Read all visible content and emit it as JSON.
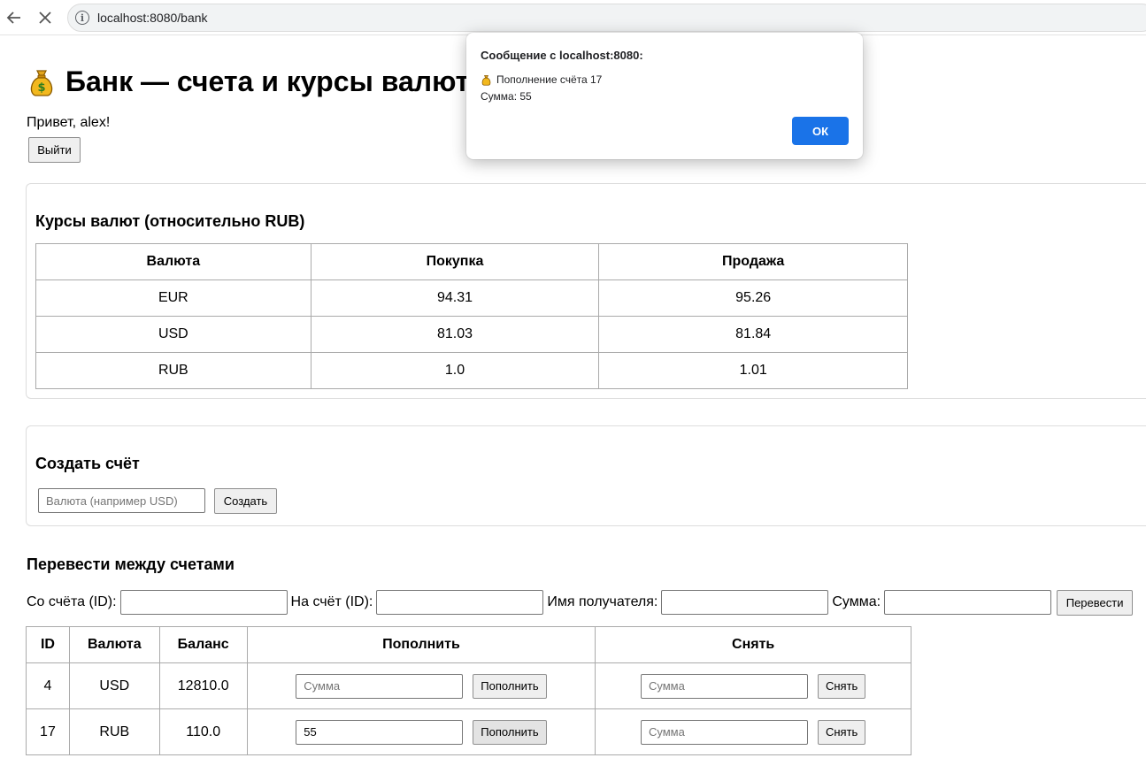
{
  "browser": {
    "url": "localhost:8080/bank",
    "back_icon": "arrow-left-icon",
    "close_icon": "close-icon",
    "info_icon": "info-icon"
  },
  "page": {
    "title": "Банк — счета и курсы валют",
    "title_icon": "money-bag-icon",
    "greeting": "Привет, alex!",
    "logout_label": "Выйти"
  },
  "rates": {
    "heading": "Курсы валют (относительно RUB)",
    "columns": [
      "Валюта",
      "Покупка",
      "Продажа"
    ],
    "rows": [
      [
        "EUR",
        "94.31",
        "95.26"
      ],
      [
        "USD",
        "81.03",
        "81.84"
      ],
      [
        "RUB",
        "1.0",
        "1.01"
      ]
    ]
  },
  "create_account": {
    "heading": "Создать счёт",
    "currency_placeholder": "Валюта (например USD)",
    "create_label": "Создать"
  },
  "transfer": {
    "heading": "Перевести между счетами",
    "from_label": "Со счёта (ID):",
    "to_label": "На счёт (ID):",
    "recipient_label": "Имя получателя:",
    "amount_label": "Сумма:",
    "from_value": "",
    "to_value": "",
    "recipient_value": "",
    "amount_value": "",
    "submit_label": "Перевести"
  },
  "accounts": {
    "columns": [
      "ID",
      "Валюта",
      "Баланс",
      "Пополнить",
      "Снять"
    ],
    "amount_placeholder": "Сумма",
    "deposit_label": "Пополнить",
    "withdraw_label": "Снять",
    "rows": [
      {
        "id": "4",
        "currency": "USD",
        "balance": "12810.0",
        "deposit_value": "",
        "withdraw_value": ""
      },
      {
        "id": "17",
        "currency": "RUB",
        "balance": "110.0",
        "deposit_value": "55",
        "withdraw_value": ""
      }
    ]
  },
  "dialog": {
    "title": "Сообщение с localhost:8080:",
    "message_line1": "Пополнение счёта 17",
    "message_line2": "Сумма: 55",
    "ok_label": "ОК"
  },
  "colors": {
    "accent": "#1a73e8",
    "border": "#aaaaaa",
    "button_bg": "#efefef"
  }
}
